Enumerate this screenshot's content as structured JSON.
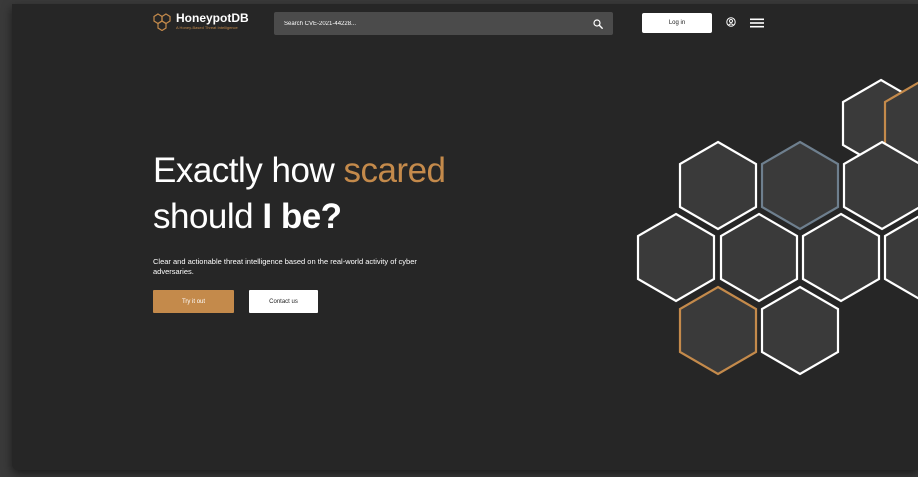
{
  "header": {
    "logo_name": "HoneypotDB",
    "logo_tagline": "A Honey-Based Threat Intelligence",
    "search_placeholder": "Search CVE-2021-44228...",
    "login_label": "Log in"
  },
  "hero": {
    "title_line1_prefix": "Exactly how ",
    "title_line1_accent": "scared",
    "title_line2_prefix": "should ",
    "title_line2_strong": "I be?",
    "description": "Clear and actionable threat intelligence based on the real-world activity of cyber adversaries.",
    "primary_button": "Try it out",
    "secondary_button": "Contact us"
  },
  "icons": {
    "logo": "hexagon-cluster-icon",
    "search": "search-icon",
    "user": "user-circle-icon",
    "menu": "hamburger-menu-icon"
  },
  "colors": {
    "background": "#262626",
    "accent": "#c48a4b",
    "search_bg": "#4b4b4b",
    "hex_fill": "#3a3a3a",
    "hex_outline_white": "#ffffff",
    "hex_outline_blue": "#6e7f8e",
    "hex_outline_orange": "#c48a4b"
  }
}
